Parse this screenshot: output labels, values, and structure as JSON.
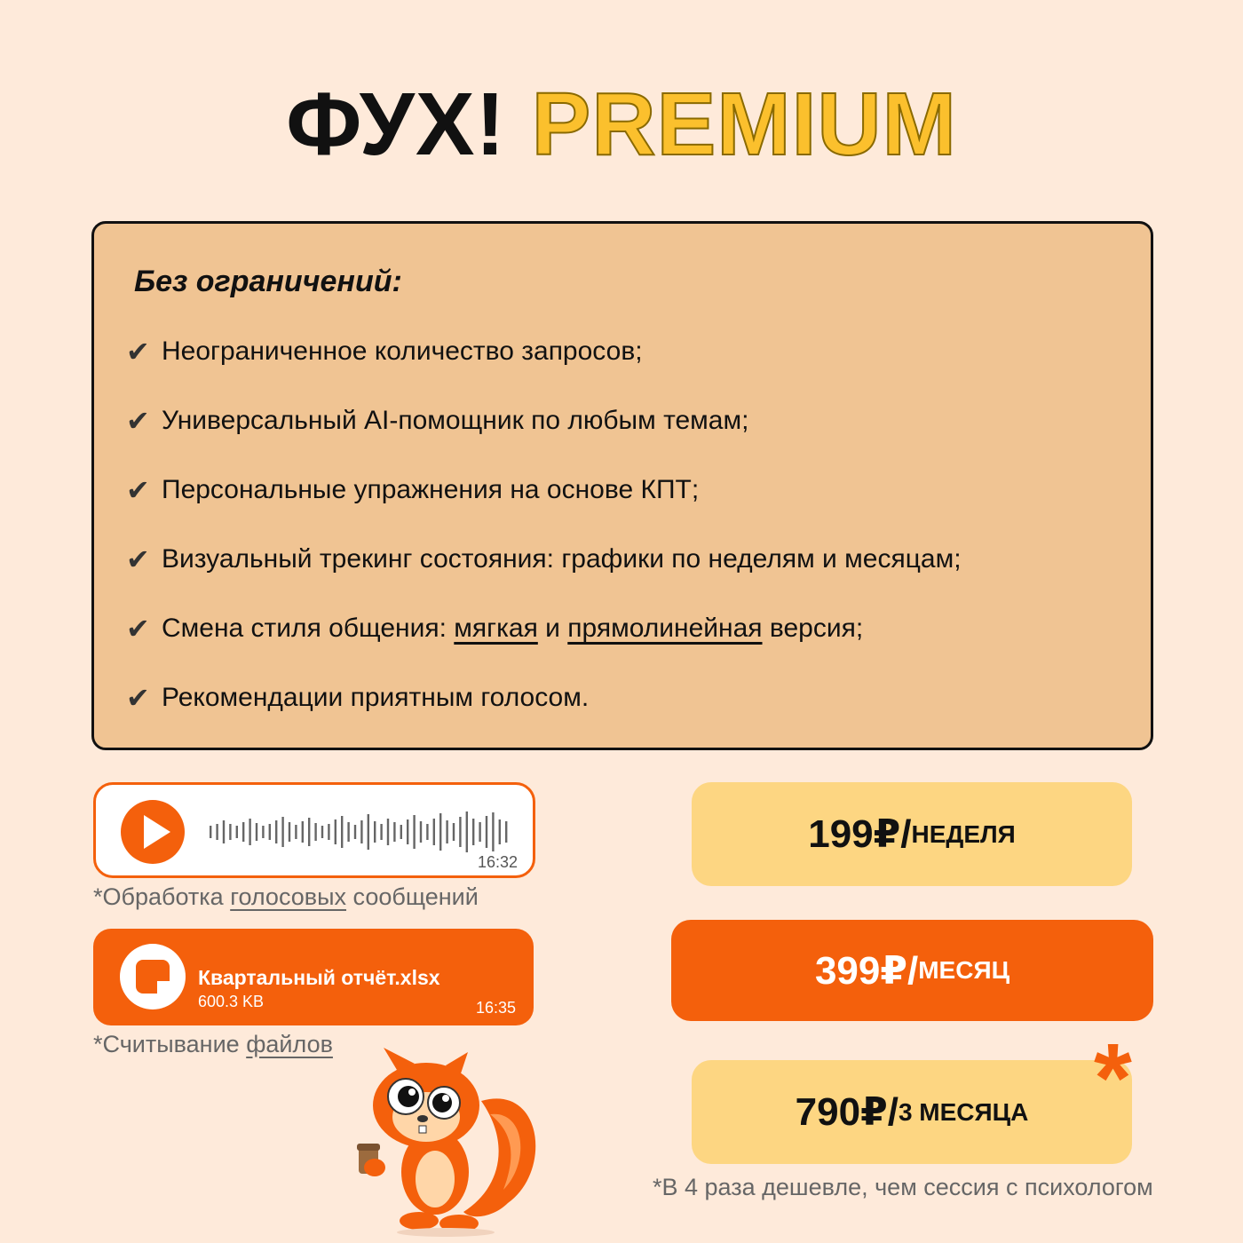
{
  "title": {
    "brand": "ФУХ!",
    "premium": "PREMIUM"
  },
  "features": {
    "heading": "Без ограничений:",
    "check_glyph": "✔",
    "items": [
      "Неограниченное количество запросов;",
      "Универсальный AI-помощник по любым темам;",
      "Персональные упражнения на основе КПТ;",
      "Визуальный трекинг состояния: графики по неделям и месяцам;"
    ],
    "style_item": {
      "prefix": "Смена стиля общения: ",
      "soft": "мягкая",
      "and": " и ",
      "direct": "прямолинейная",
      "suffix": " версия;"
    },
    "last_item": "Рекомендации приятным голосом."
  },
  "voice_message": {
    "time": "16:32",
    "icon": "play-icon",
    "caption_prefix": "*Обработка ",
    "caption_link": "голосовых",
    "caption_suffix": " сообщений"
  },
  "file_message": {
    "name": "Квартальный отчёт.xlsx",
    "size": "600.3 KB",
    "time": "16:35",
    "icon": "document-icon",
    "caption_prefix": "*Считывание ",
    "caption_link": "файлов"
  },
  "pricing": {
    "weekly": {
      "amount": "199₽/",
      "period": "НЕДЕЛЯ"
    },
    "monthly": {
      "amount": "399₽/",
      "period": "МЕСЯЦ"
    },
    "quarterly": {
      "amount": "790₽/",
      "period": "3 МЕСЯЦА"
    },
    "asterisk": "*",
    "note": "*В 4 раза дешевле, чем сессия с психологом"
  },
  "colors": {
    "background": "#FEEADA",
    "card": "#F0C493",
    "accent_orange": "#F4600C",
    "accent_yellow": "#FBC02D",
    "price_yellow": "#FDD682"
  }
}
